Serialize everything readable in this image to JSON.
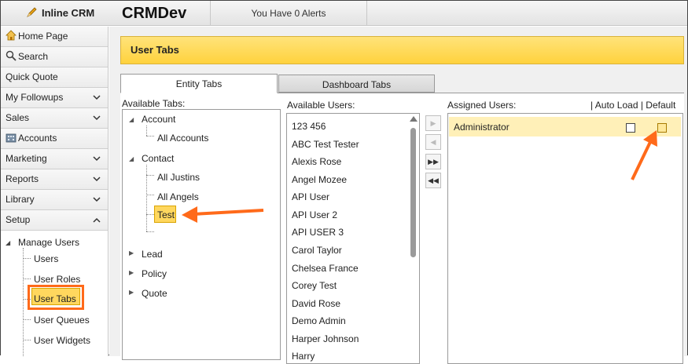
{
  "header": {
    "logo_text": "Inline CRM",
    "app_title": "CRMDev",
    "alerts_text": "You Have 0 Alerts"
  },
  "sidebar": {
    "items": [
      {
        "label": "Home Page",
        "icon": "home-icon"
      },
      {
        "label": "Search",
        "icon": "search-icon"
      },
      {
        "label": "Quick Quote"
      },
      {
        "label": "My Followups",
        "chevron": "down"
      },
      {
        "label": "Sales",
        "chevron": "down"
      },
      {
        "label": "Accounts",
        "icon": "accounts-icon"
      },
      {
        "label": "Marketing",
        "chevron": "down"
      },
      {
        "label": "Reports",
        "chevron": "down"
      },
      {
        "label": "Library",
        "chevron": "down"
      },
      {
        "label": "Setup",
        "chevron": "up"
      }
    ],
    "setup_tree": {
      "root": "Manage Users",
      "children": [
        "Users",
        "User Roles",
        "User Tabs",
        "User Queues",
        "User Widgets"
      ],
      "selected": "User Tabs"
    }
  },
  "main": {
    "banner_title": "User Tabs",
    "tabs": [
      {
        "label": "Entity Tabs",
        "active": true
      },
      {
        "label": "Dashboard Tabs",
        "active": false
      }
    ],
    "available_tabs_label": "Available Tabs:",
    "available_users_label": "Available Users:",
    "assigned_users_label": "Assigned Users:",
    "auto_load_default_label": "| Auto Load | Default",
    "tree": {
      "account": "Account",
      "all_accounts": "All Accounts",
      "contact": "Contact",
      "all_justins": "All Justins",
      "all_angels": "All Angels",
      "test": "Test",
      "lead": "Lead",
      "policy": "Policy",
      "quote": "Quote"
    },
    "available_users": [
      "123 456",
      "ABC Test Tester",
      "Alexis Rose",
      "Angel Mozee",
      "API User",
      "API User 2",
      "API USER 3",
      "Carol Taylor",
      "Chelsea France",
      "Corey Test",
      "David Rose",
      "Demo Admin",
      "Harper Johnson",
      "Harry"
    ],
    "move_buttons": [
      {
        "icon": "move-right-icon",
        "glyph": "▶",
        "enabled": false
      },
      {
        "icon": "move-left-icon",
        "glyph": "◀",
        "enabled": false
      },
      {
        "icon": "move-all-right-icon",
        "glyph": "▶▶",
        "enabled": true
      },
      {
        "icon": "move-all-left-icon",
        "glyph": "◀◀",
        "enabled": true
      }
    ],
    "assigned_users": [
      {
        "name": "Administrator",
        "auto_load": false,
        "default": false
      }
    ]
  },
  "colors": {
    "banner": "#ffd23d",
    "highlight": "#ffd75e",
    "annotation_arrow": "#ff6a1a"
  }
}
